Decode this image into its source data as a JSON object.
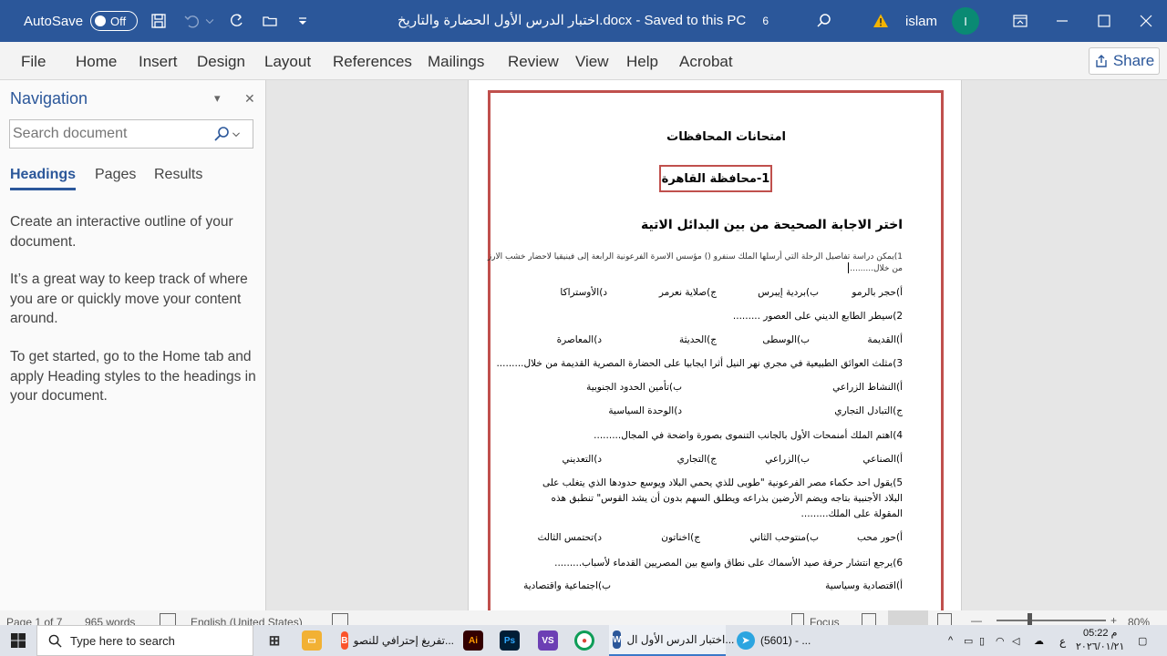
{
  "titlebar": {
    "autosave_label": "AutoSave",
    "autosave_state": "Off",
    "document_title": "اختبار الدرس الأول الحضارة والتاريخ.docx  -  Saved to this PC",
    "badge": "6",
    "user_name": "islam",
    "avatar_initial": "I",
    "accent_color": "#2b579a"
  },
  "ribbon": {
    "tabs": [
      "File",
      "Home",
      "Insert",
      "Design",
      "Layout",
      "References",
      "Mailings",
      "Review",
      "View",
      "Help",
      "Acrobat"
    ],
    "share_label": "Share"
  },
  "navigation": {
    "title": "Navigation",
    "search_placeholder": "Search document",
    "tabs": [
      "Headings",
      "Pages",
      "Results"
    ],
    "active_tab": "Headings",
    "paragraphs": [
      "Create an interactive outline of your document.",
      "It’s a great way to keep track of where you are or quickly move your content around.",
      "To get started, go to the Home tab and apply Heading styles to the headings in your document."
    ]
  },
  "document": {
    "title": "امتحانات المحافظات",
    "governorate": "1-محافظة القاهرة",
    "instruction": "اختر الاجابة الصحيحة من بين البدائل الاتية",
    "lines": {
      "q1a": "1)يمكن دراسة تفاصيل الرحلة التي أرسلها الملك سنفرو () مؤسس الاسرة الفرعونية الرابعة إلى فينيقيا لاحضار خشب الارز",
      "q1b": "من خلال.........",
      "q1_o1": "أ)حجر بالرمو",
      "q1_o2": "ب)بردية إيبرس",
      "q1_o3": "ج)صلاية نعرمر",
      "q1_o4": "د)الأوستراكا",
      "q2": "2)سيطر الطابع الديني على العصور .........",
      "q2_o1": "أ)القديمة",
      "q2_o2": "ب)الوسطى",
      "q2_o3": "ج)الحديثة",
      "q2_o4": "د)المعاصرة",
      "q3": "3)مثلث العوائق الطبيعية في مجري نهر النيل أثرا ايجابيا على الحضارة المصرية القديمة من خلال.........",
      "q3_o1": "أ)النشاط الزراعي",
      "q3_o2": "ب)تأمين الحدود الجنوبية",
      "q3_o3": "ج)التبادل التجاري",
      "q3_o4": "د)الوحدة السياسية",
      "q4": "4)اهتم الملك أمنمحات الأول بالجانب التنموى بصورة واضحة في المجال.........",
      "q4_o1": "أ)الصناعي",
      "q4_o2": "ب)الزراعي",
      "q4_o3": "ج)التجاري",
      "q4_o4": "د)التعديني",
      "q5": "5)يقول احد حكماء مصر الفرعونية \"طوبى للذي يحمي البلاد ويوسع حدودها الذي يتغلب على البلاد الأجنبية بتاجه ويضم الأرضين بذراعه ويطلق السهم بدون أن يشد القوس\" تنطبق هذه المقولة على الملك.........",
      "q5_o1": "أ)حور محب",
      "q5_o2": "ب)منتوحب الثاني",
      "q5_o3": "ج)اخناتون",
      "q5_o4": "د)تحتمس الثالث",
      "q6": "6)يرجع انتشار حرفة صيد الأسماك على نطاق واسع بين المصريين القدماء لأسباب.........",
      "q6_o1": "أ)اقتصادية وسياسية",
      "q6_o2": "ب)اجتماعية واقتصادية"
    },
    "border_color": "#c0504d"
  },
  "statusbar": {
    "page": "Page 1 of 7",
    "words": "965 words",
    "language": "English (United States)",
    "focus": "Focus",
    "zoom": "80%"
  },
  "taskbar": {
    "search_placeholder": "Type here to search",
    "brave_label": "تفريغ إحترافي للنصو...",
    "word_label": "اختبار الدرس الأول ال...",
    "telegram_label": "(5601) - ...",
    "clock_time": "05:22 م",
    "clock_date": "٢٠٢٦/٠١/٢١",
    "lang": "ع"
  }
}
